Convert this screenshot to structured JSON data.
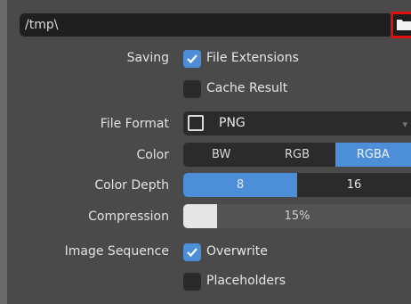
{
  "file": {
    "path_value": "/tmp\\",
    "browse_icon": "folder-icon"
  },
  "saving": {
    "label": "Saving",
    "file_extensions": {
      "label": "File Extensions",
      "checked": true
    },
    "cache_result": {
      "label": "Cache Result",
      "checked": false
    }
  },
  "file_format": {
    "label": "File Format",
    "value": "PNG",
    "icon": "image-icon"
  },
  "color": {
    "label": "Color",
    "options": [
      "BW",
      "RGB",
      "RGBA"
    ],
    "selected": "RGBA"
  },
  "color_depth": {
    "label": "Color Depth",
    "options": [
      "8",
      "16"
    ],
    "selected": "8"
  },
  "compression": {
    "label": "Compression",
    "value_text": "15%",
    "fraction": 0.15
  },
  "image_sequence": {
    "label": "Image Sequence",
    "overwrite": {
      "label": "Overwrite",
      "checked": true
    },
    "placeholders": {
      "label": "Placeholders",
      "checked": false
    }
  },
  "colors": {
    "accent": "#4c8ed8",
    "highlight_border": "#e20e0e"
  }
}
